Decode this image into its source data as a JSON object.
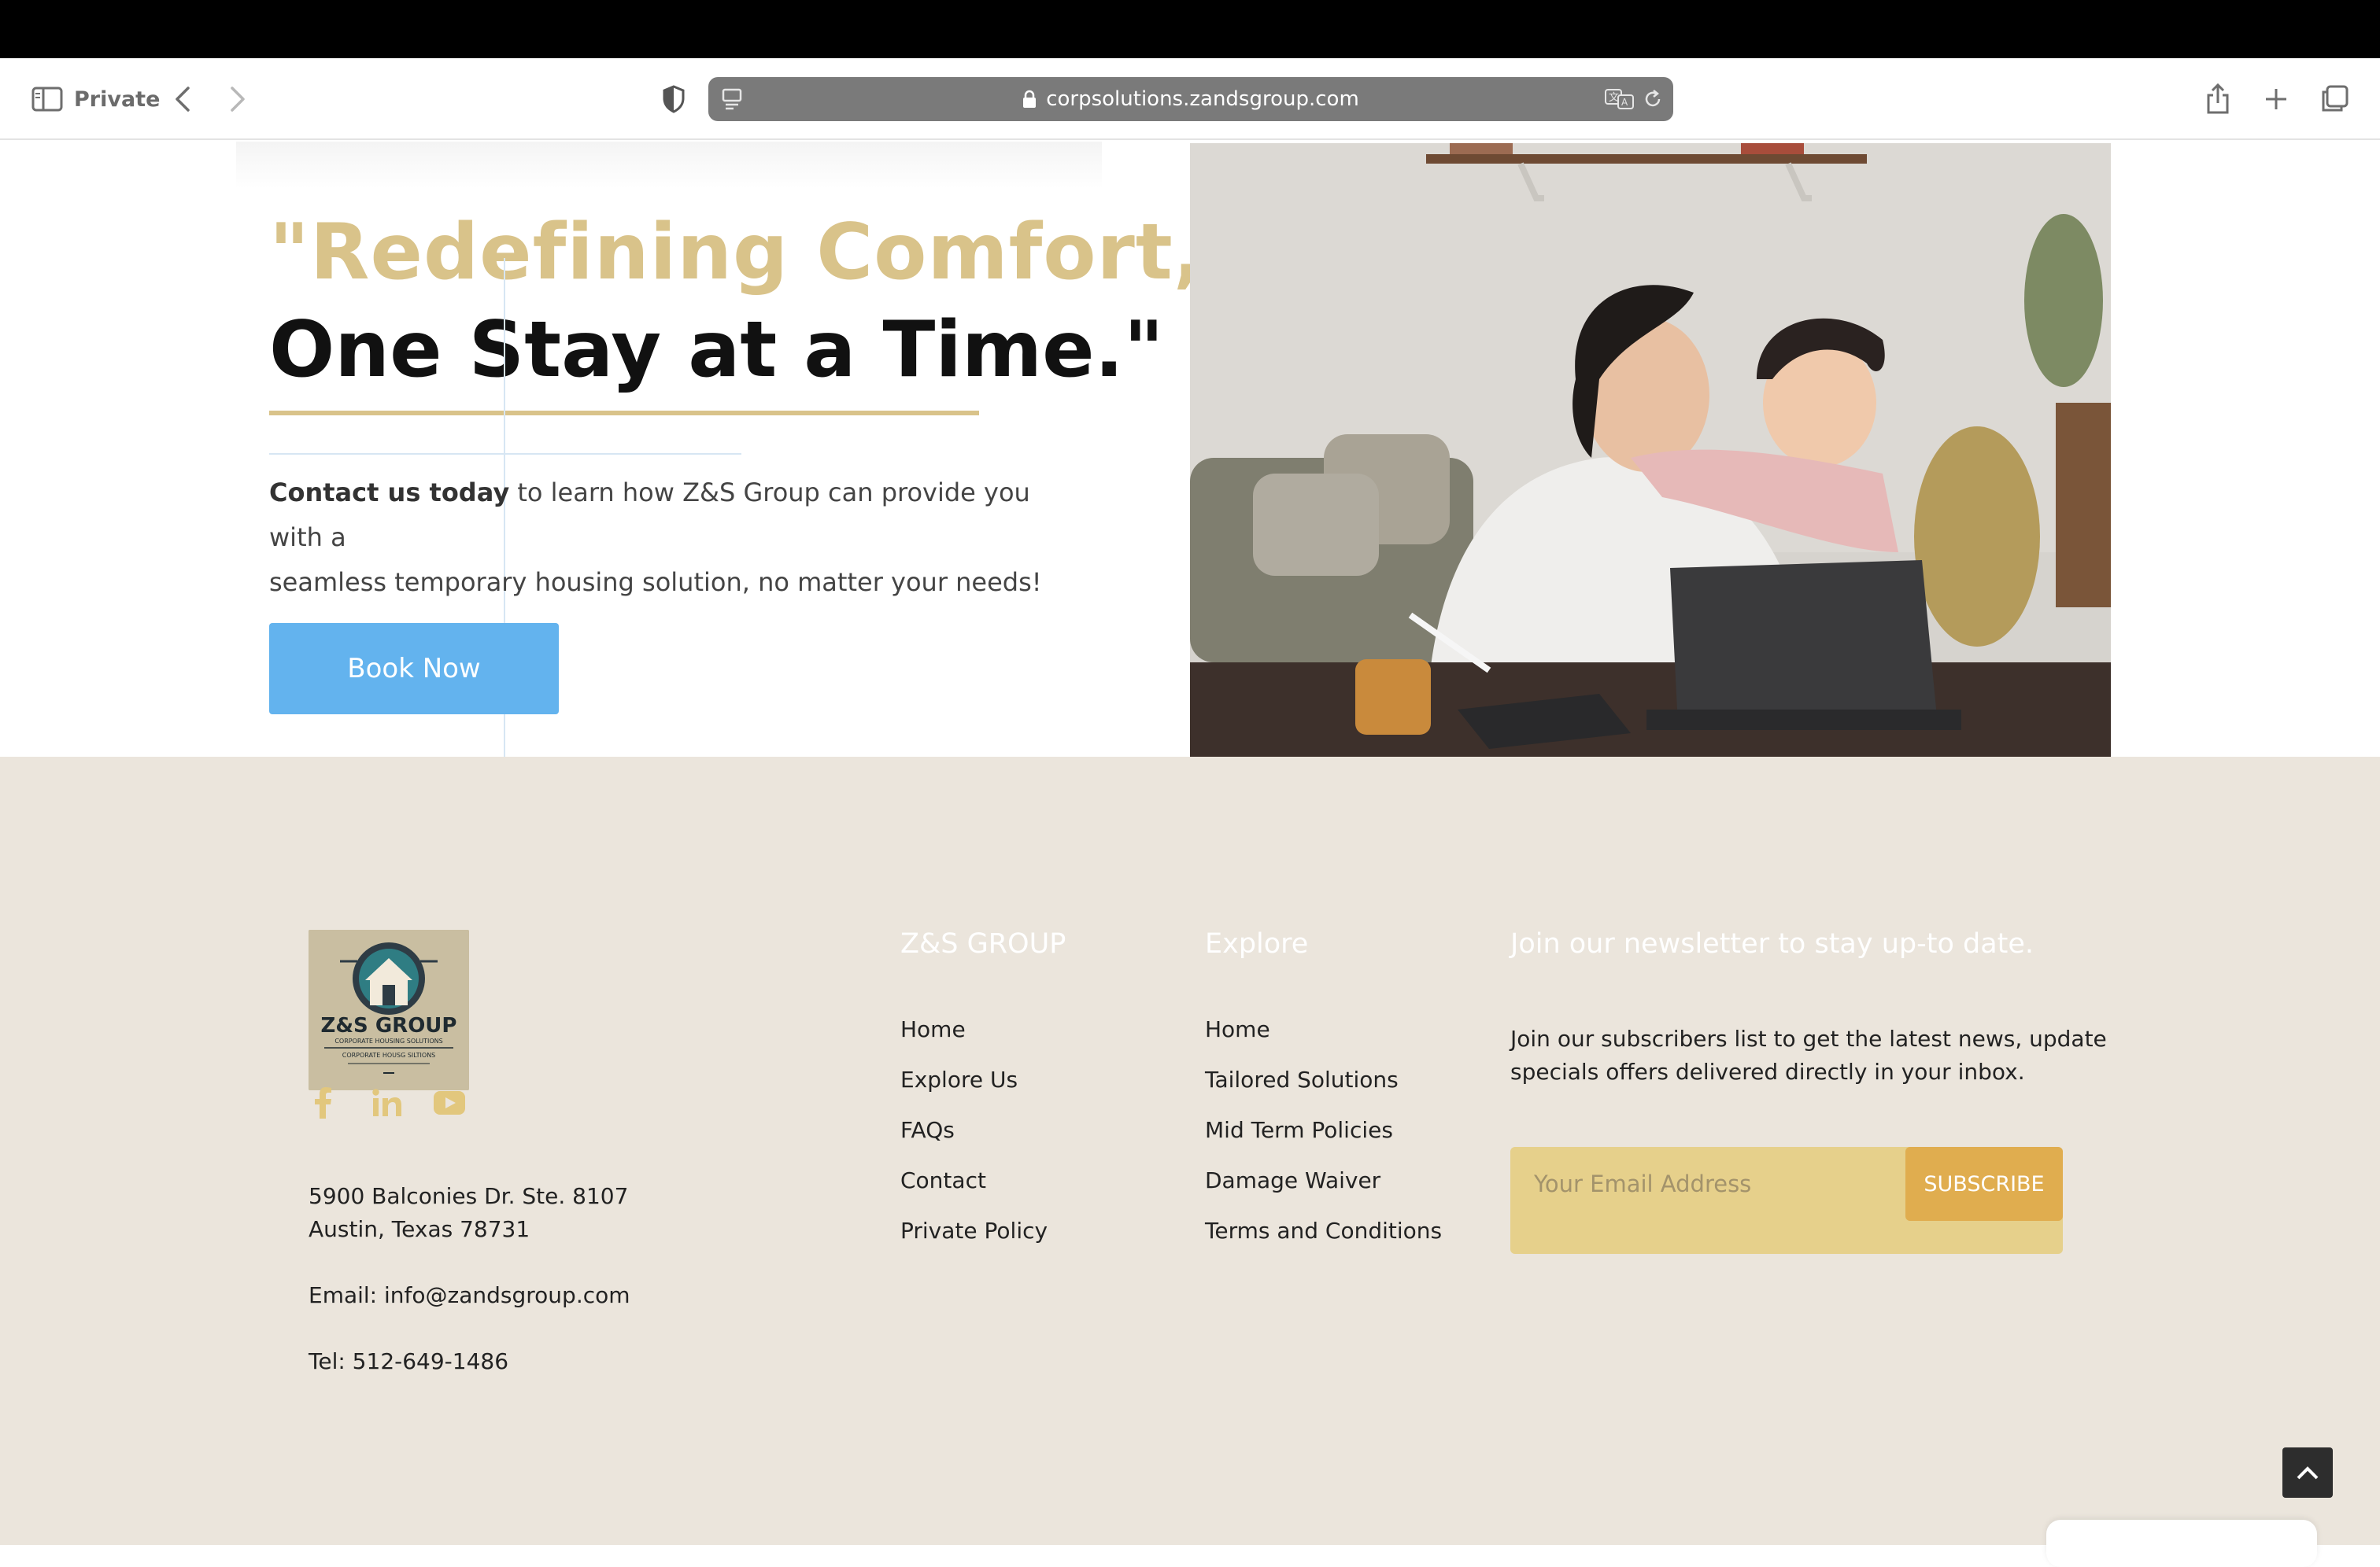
{
  "browser": {
    "private_label": "Private",
    "url": "corpsolutions.zandsgroup.com"
  },
  "hero": {
    "quote_line1": "\"Redefining Comfort,",
    "quote_line2": "One Stay at a Time.\"",
    "para_bold": "Contact us today",
    "para_line1_rest": " to learn how Z&S Group can provide you with a",
    "para_line2": "seamless temporary housing solution, no matter your needs!",
    "book_button": "Book Now"
  },
  "footer": {
    "logo": {
      "title": "Z&S GROUP",
      "sub1": "CORPORATE HOUSING SOLUTIONS",
      "sub2": "CORPORATE HOUSG SILTIONS"
    },
    "address_line1": "5900 Balconies Dr. Ste. 8107",
    "address_line2": "Austin, Texas 78731",
    "email": "Email: info@zandsgroup.com",
    "tel": "Tel: 512-649-1486",
    "col1": {
      "heading": "Z&S GROUP",
      "links": [
        "Home",
        "Explore Us",
        "FAQs",
        "Contact",
        "Private Policy"
      ]
    },
    "col2": {
      "heading": "Explore",
      "links": [
        "Home",
        "Tailored Solutions",
        "Mid Term Policies",
        "Damage Waiver",
        "Terms and Conditions"
      ]
    },
    "newsletter": {
      "heading": "Join our newsletter to stay up-to date.",
      "text": "Join our subscribers list to get the latest news, update specials offers delivered directly in your inbox.",
      "placeholder": "Your Email Address",
      "button": "SUBSCRIBE"
    }
  },
  "colors": {
    "gold": "#d9c38a",
    "button_blue": "#63b3ee",
    "footer_bg": "#ebe5dc",
    "subscribe": "#e0ad4f"
  }
}
